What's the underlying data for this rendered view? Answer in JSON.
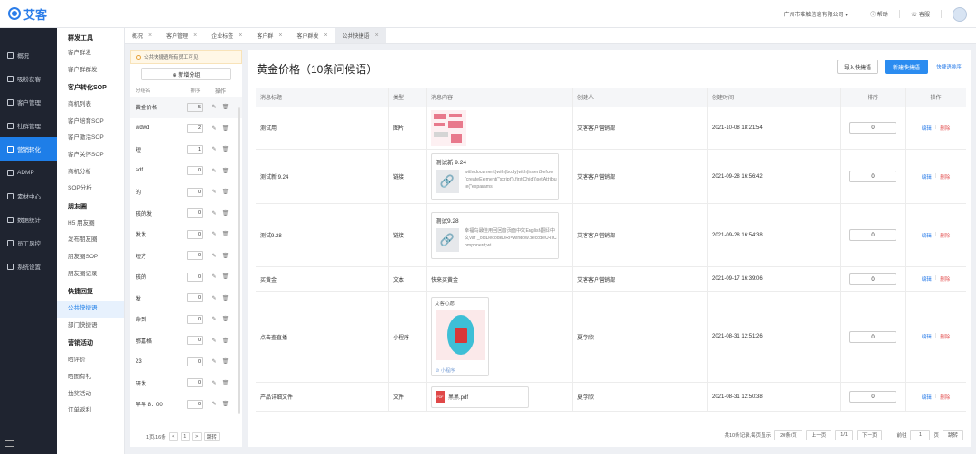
{
  "header": {
    "brand": "艾客",
    "company": "广州市唯触信息有限公司 ▾",
    "help": "帮助",
    "service": "客服"
  },
  "sidebar": {
    "items": [
      {
        "label": "概况",
        "icon": "home-icon"
      },
      {
        "label": "吸粉获客",
        "icon": "user-add-icon"
      },
      {
        "label": "客户管理",
        "icon": "users-icon"
      },
      {
        "label": "社群管理",
        "icon": "group-icon"
      },
      {
        "label": "营销转化",
        "icon": "marketing-icon"
      },
      {
        "label": "ADMP",
        "icon": "admp-icon"
      },
      {
        "label": "素材中心",
        "icon": "material-icon"
      },
      {
        "label": "数据统计",
        "icon": "chart-icon"
      },
      {
        "label": "员工风控",
        "icon": "shield-icon"
      },
      {
        "label": "系统设置",
        "icon": "gear-icon"
      }
    ],
    "active_index": 4
  },
  "submenu": {
    "groups": [
      {
        "title": "群发工具",
        "items": [
          "客户群发",
          "客户群群发"
        ]
      },
      {
        "title": "客户转化SOP",
        "items": [
          "商机列表",
          "客户培育SOP",
          "客户激活SOP",
          "客户关怀SOP",
          "商机分析",
          "SOP分析"
        ]
      },
      {
        "title": "朋友圈",
        "items": [
          "H5 朋友圈",
          "发布朋友圈",
          "朋友圈SOP",
          "朋友圈记录"
        ]
      },
      {
        "title": "快捷回复",
        "items": [
          "公共快捷语",
          "部门快捷语"
        ]
      },
      {
        "title": "营销活动",
        "items": [
          "晒评价",
          "晒图有礼",
          "抽奖活动",
          "订单返利"
        ]
      }
    ],
    "active": "公共快捷语"
  },
  "tabs": [
    {
      "label": "概况"
    },
    {
      "label": "客户管理"
    },
    {
      "label": "企业标签"
    },
    {
      "label": "客户群"
    },
    {
      "label": "客户群发"
    },
    {
      "label": "公共快捷语"
    }
  ],
  "group_panel": {
    "notice": "公共快捷语所有员工可见",
    "add_button": "⊕ 新增分组",
    "col_name": "分组名",
    "col_order": "排序",
    "col_action": "操作",
    "rows": [
      {
        "name": "黄金价格",
        "order": "5"
      },
      {
        "name": "wdwd",
        "order": "2"
      },
      {
        "name": "短",
        "order": "1"
      },
      {
        "name": "sdf",
        "order": "0"
      },
      {
        "name": "的",
        "order": "0"
      },
      {
        "name": "孩的发",
        "order": "0"
      },
      {
        "name": "发发",
        "order": "0"
      },
      {
        "name": "短方",
        "order": "0"
      },
      {
        "name": "孩的",
        "order": "0"
      },
      {
        "name": "发",
        "order": "0"
      },
      {
        "name": "命到",
        "order": "0"
      },
      {
        "name": "鄂嘉格",
        "order": "0"
      },
      {
        "name": "23",
        "order": "0"
      },
      {
        "name": "研发",
        "order": "0"
      },
      {
        "name": "早早 8：00",
        "order": "0"
      }
    ],
    "pager": {
      "info": "1页/16条",
      "prev": "<",
      "page": "1",
      "next": ">",
      "jump": "跳转"
    }
  },
  "main": {
    "title": "黄金价格（10条问候语）",
    "import_btn": "导入快捷语",
    "new_btn": "新建快捷语",
    "sort_link": "快捷语排序",
    "columns": [
      "消息标题",
      "类型",
      "消息内容",
      "创建人",
      "创建时间",
      "排序",
      "操作"
    ],
    "edit": "编辑",
    "delete": "删除",
    "rows": [
      {
        "title": "测试用",
        "type": "图片",
        "content": "",
        "creator": "艾客客户营销部",
        "time": "2021-10-08 18:21:54",
        "order": "0"
      },
      {
        "title": "测试新 9.24",
        "type": "链接",
        "link_title": "测试新 9.24",
        "link_desc": "with(document)with(body)with(insertBefore(createElement(\"script\"),firstChild))setAttribute(\"exparams",
        "creator": "艾客客户营销部",
        "time": "2021-09-28 16:56:42",
        "order": "0"
      },
      {
        "title": "测试9.28",
        "type": "链接",
        "link_title": "测试9.28",
        "link_desc": "幸福鸟最佳用回回音页面中文English翻译中文var _oldDecodeURI=window.decodeURIComponent;wi...",
        "creator": "艾客客户营销部",
        "time": "2021-09-28 16:54:38",
        "order": "0"
      },
      {
        "title": "买黄金",
        "type": "文本",
        "content": "快来买黄金",
        "creator": "艾客客户营销部",
        "time": "2021-09-17 16:39:06",
        "order": "0"
      },
      {
        "title": "点击查直播",
        "type": "小程序",
        "mini_title": "艾客心愿",
        "mini_footer": "⊘ 小程序",
        "creator": "夏学欣",
        "time": "2021-08-31 12:51:26",
        "order": "0"
      },
      {
        "title": "产品详细文件",
        "type": "文件",
        "file_name": "黑黑.pdf",
        "file_badge": "PDF",
        "creator": "夏学欣",
        "time": "2021-08-31 12:50:38",
        "order": "0"
      }
    ],
    "pager": {
      "info": "共10条记录,每页显示",
      "size": "20条/页",
      "prev": "上一页",
      "page": "1/1",
      "next": "下一页",
      "goto_label": "前往",
      "goto_value": "1",
      "page_suffix": "页",
      "jump": "跳转"
    }
  },
  "colors": {
    "primary": "#2b8cf0",
    "sidebar_bg": "#1f2430",
    "delete": "#e45656"
  }
}
